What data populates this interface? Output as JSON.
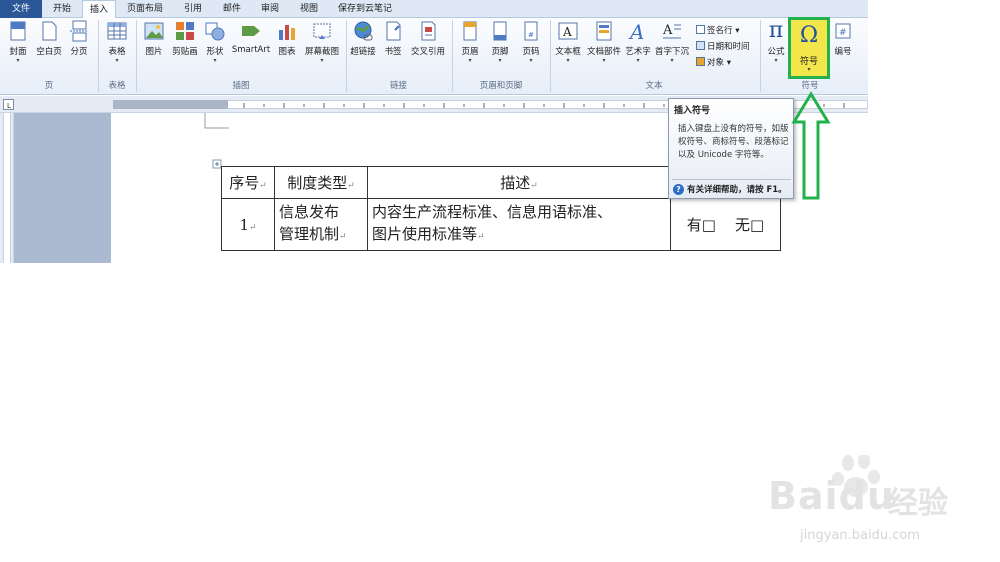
{
  "tabs": [
    {
      "label": "文件"
    },
    {
      "label": "开始"
    },
    {
      "label": "插入"
    },
    {
      "label": "页面布局"
    },
    {
      "label": "引用"
    },
    {
      "label": "邮件"
    },
    {
      "label": "审阅"
    },
    {
      "label": "视图"
    },
    {
      "label": "保存到云笔记"
    }
  ],
  "ribbon": {
    "cover": "封面",
    "blank": "空白页",
    "break": "分页",
    "table": "表格",
    "picture": "图片",
    "clipart": "剪贴画",
    "shapes": "形状",
    "smartart": "SmartArt",
    "chart": "图表",
    "screenshot": "屏幕截图",
    "hyperlink": "超链接",
    "bookmark": "书签",
    "crossref": "交叉引用",
    "header": "页眉",
    "footer": "页脚",
    "pagenum": "页码",
    "textbox": "文本框",
    "quickparts": "文档部件",
    "wordart": "艺术字",
    "dropcap": "首字下沉",
    "signature": "签名行",
    "datetime": "日期和时间",
    "object": "对象",
    "equation": "公式",
    "symbol": "符号",
    "number": "编号",
    "groups": {
      "pages": "页",
      "tables": "表格",
      "illustrations": "插图",
      "links": "链接",
      "headerfooter": "页眉和页脚",
      "text": "文本",
      "symbols": "符号"
    }
  },
  "ruler": {
    "box": "L"
  },
  "table": {
    "header": [
      "序号",
      "制度类型",
      "描述",
      ""
    ],
    "row": {
      "num": "1",
      "type_line1": "信息发布",
      "type_line2": "管理机制",
      "desc_line1": "内容生产流程标准、信息用语标准、",
      "desc_line2": "图片使用标准等",
      "yes": "有□",
      "no": "无□"
    }
  },
  "tooltip": {
    "title": "插入符号",
    "body": "插入键盘上没有的符号，如版权符号、商标符号、段落标记以及 Unicode 字符等。",
    "help": "有关详细帮助，请按 F1。"
  },
  "watermark": {
    "brand": "Bai",
    "brand2": "du",
    "cn": "经验",
    "url": "jingyan.baidu.com"
  },
  "colors": {
    "highlight_border": "#22b14c",
    "highlight_fill": "#f3e64a",
    "file_tab": "#2b5797"
  }
}
